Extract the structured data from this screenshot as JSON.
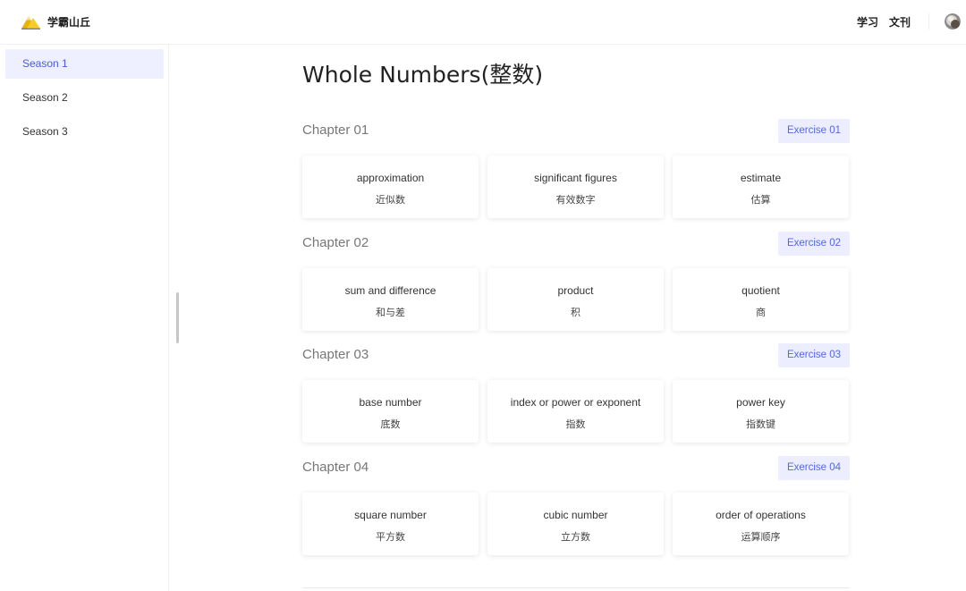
{
  "app": {
    "brand_name": "学霸山丘"
  },
  "topnav": {
    "items": [
      {
        "label": "学习"
      },
      {
        "label": "文刊"
      }
    ]
  },
  "sidebar": {
    "items": [
      {
        "label": "Season 1",
        "active": true
      },
      {
        "label": "Season 2"
      },
      {
        "label": "Season 3"
      }
    ]
  },
  "main": {
    "title": "Whole Numbers(整数)",
    "chapters": [
      {
        "title": "Chapter 01",
        "exercise": "Exercise 01",
        "cards": [
          {
            "en": "approximation",
            "zh": "近似数"
          },
          {
            "en": "significant figures",
            "zh": "有效数字"
          },
          {
            "en": "estimate",
            "zh": "估算"
          }
        ]
      },
      {
        "title": "Chapter 02",
        "exercise": "Exercise 02",
        "cards": [
          {
            "en": "sum and difference",
            "zh": "和与差"
          },
          {
            "en": "product",
            "zh": "积"
          },
          {
            "en": "quotient",
            "zh": "商"
          }
        ]
      },
      {
        "title": "Chapter 03",
        "exercise": "Exercise 03",
        "cards": [
          {
            "en": "base number",
            "zh": "底数"
          },
          {
            "en": "index or power or exponent",
            "zh": "指数"
          },
          {
            "en": "power key",
            "zh": "指数键"
          }
        ]
      },
      {
        "title": "Chapter 04",
        "exercise": "Exercise 04",
        "cards": [
          {
            "en": "square number",
            "zh": "平方数"
          },
          {
            "en": "cubic number",
            "zh": "立方数"
          },
          {
            "en": "order of operations",
            "zh": "运算顺序"
          }
        ]
      }
    ]
  },
  "colors": {
    "accent": "#4a5bdc",
    "accent_bg": "#eef0ff",
    "exercise_bg": "#eceeff"
  },
  "icons": {
    "logo": "mountain-logo-icon",
    "avatar": "user-avatar"
  }
}
